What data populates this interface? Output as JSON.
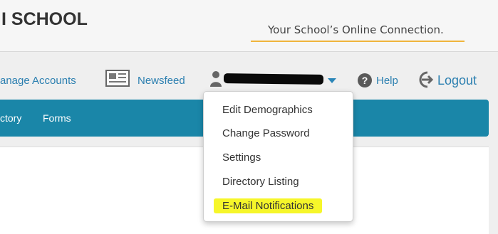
{
  "header": {
    "school_title": "I SCHOOL",
    "tagline": "Your School’s Online Connection."
  },
  "topbar": {
    "manage_accounts": "anage Accounts",
    "newsfeed": "Newsfeed",
    "user_icon": "person-icon",
    "dropdown_caret": "caret-down-icon",
    "help": "Help",
    "logout": "Logout"
  },
  "nav": {
    "items": [
      "ctory",
      "Forms"
    ]
  },
  "user_menu": {
    "items": [
      {
        "label": "Edit Demographics"
      },
      {
        "label": "Change Password"
      },
      {
        "label": "Settings"
      },
      {
        "label": "Directory Listing"
      },
      {
        "label": "E-Mail Notifications",
        "highlighted": true
      }
    ]
  },
  "colors": {
    "link": "#2b7fb0",
    "navbar": "#1a86a8",
    "tagline_underline": "#f0b43c",
    "highlight": "#f6f62a"
  }
}
